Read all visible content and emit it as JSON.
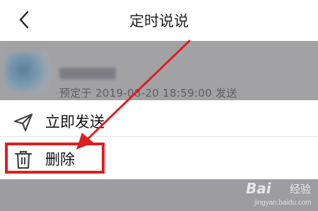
{
  "header": {
    "title": "定时说说",
    "back_icon": "chevron-left-icon"
  },
  "post": {
    "meta": "预定于 2019-08-20 18:59:00 发送"
  },
  "sheet": {
    "send_now": {
      "label": "立即发送",
      "icon": "paper-plane-icon"
    },
    "delete": {
      "label": "删除",
      "icon": "trash-icon"
    }
  },
  "annotation": {
    "highlight_color": "#dd1f1f",
    "arrow_color": "#dd1f1f"
  },
  "watermark": {
    "brand": "Bai",
    "brand_cn": "经验",
    "domain": "jingyan.baidu.com"
  }
}
